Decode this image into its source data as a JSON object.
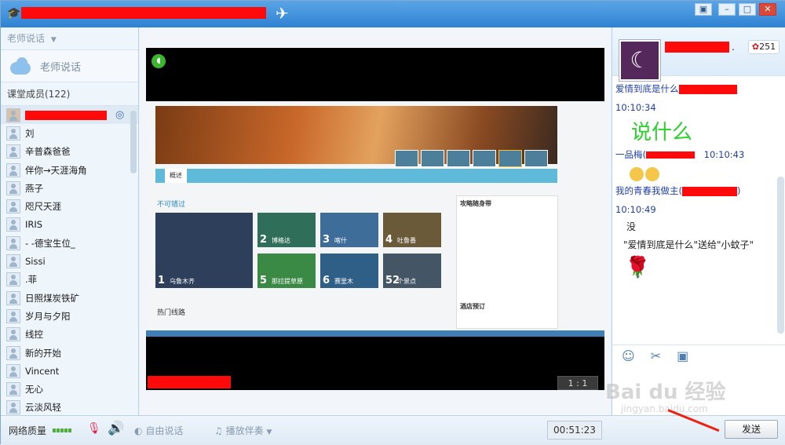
{
  "sidebar": {
    "teacher_section_label": "老师说话",
    "teacher_card_label": "老师说话",
    "members_header": "课堂成员(122)",
    "members": [
      "刘",
      "辛普森爸爸",
      "伴你→天涯海角",
      "燕子",
      "咫尺天涯",
      "IRIS",
      "- -德宝生位_",
      "Sissi",
      ".菲",
      "日照煤炭铁矿",
      "岁月与夕阳",
      "线控",
      "新的开始",
      "Vincent",
      "无心",
      "云淡风轻"
    ]
  },
  "video": {
    "ratio_label": "1 : 1",
    "page_nav_tab": "概述",
    "section_must_see": "不可错过",
    "section_hot_routes": "热门线路",
    "tiles": [
      {
        "num": "1",
        "name": "乌鲁木齐"
      },
      {
        "num": "2",
        "name": "博格达"
      },
      {
        "num": "3",
        "name": "喀什"
      },
      {
        "num": "4",
        "name": "吐鲁番"
      },
      {
        "num": "5",
        "name": "那拉提草原"
      },
      {
        "num": "6",
        "name": "赛里木"
      },
      {
        "num": "52",
        "name": "个景点"
      }
    ],
    "side_panel_title": "攻略随身带",
    "hotel_title": "酒店预订"
  },
  "chat": {
    "flower_count": "251",
    "messages": [
      {
        "name": "爱情到底是什么",
        "time": "10:10:34",
        "text": "说什么"
      },
      {
        "name": "一品梅(",
        "time": "10:10:43",
        "text": ""
      },
      {
        "name": "我的青春我做主(",
        "time": "10:10:49",
        "text": "没"
      }
    ],
    "gift_notice": "\"爱情到底是什么\"送给\"小蚊子\""
  },
  "bottom": {
    "network_label": "网络质量",
    "free_speak_label": "自由说话",
    "accompaniment_label": "播放伴奏",
    "timer": "00:51:23",
    "send_label": "发送"
  },
  "watermark": {
    "main": "Bai du 经验",
    "sub": "jingyan.baidu.com"
  }
}
